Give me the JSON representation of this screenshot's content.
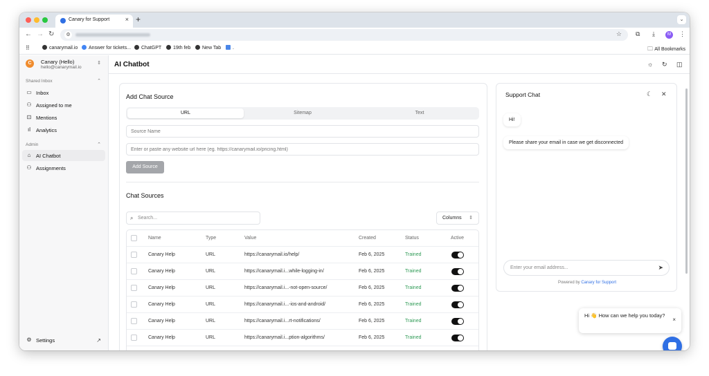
{
  "browser": {
    "tab_title": "Canary for Support",
    "tab_close": "×",
    "new_tab": "+",
    "menu": "⌄",
    "bookmarks": [
      {
        "label": "canarymail.io"
      },
      {
        "label": "Answer for tickets..."
      },
      {
        "label": "ChatGPT"
      },
      {
        "label": "19th feb"
      },
      {
        "label": "New Tab"
      },
      {
        "label": "."
      }
    ],
    "all_bookmarks": "All Bookmarks",
    "profile_initial": "M"
  },
  "workspace": {
    "avatar": "C",
    "name": "Canary (Hello)",
    "email": "hello@canarymail.io"
  },
  "sidebar": {
    "shared_inbox_label": "Shared Inbox",
    "shared_items": [
      {
        "label": "Inbox",
        "icon": "inbox-icon"
      },
      {
        "label": "Assigned to me",
        "icon": "user-check-icon"
      },
      {
        "label": "Mentions",
        "icon": "mention-icon"
      },
      {
        "label": "Analytics",
        "icon": "bar-chart-icon"
      }
    ],
    "admin_label": "Admin",
    "admin_items": [
      {
        "label": "AI Chatbot",
        "icon": "bot-icon",
        "active": true
      },
      {
        "label": "Assignments",
        "icon": "users-icon"
      }
    ],
    "settings_label": "Settings"
  },
  "header": {
    "title": "AI Chatbot"
  },
  "add_source": {
    "title": "Add Chat Source",
    "tabs": [
      "URL",
      "Sitemap",
      "Text"
    ],
    "active_tab": "URL",
    "source_name_placeholder": "Source Name",
    "url_placeholder": "Enter or paste any website url here (eg. https://canarymail.io/pricing.html)",
    "add_button": "Add Source"
  },
  "chat_sources": {
    "title": "Chat Sources",
    "search_placeholder": "Search...",
    "columns_button": "Columns",
    "headers": [
      "Name",
      "Type",
      "Value",
      "Created",
      "Status",
      "Active"
    ],
    "rows": [
      {
        "name": "Canary Help",
        "type": "URL",
        "value": "https://canarymail.io/help/",
        "created": "Feb 6, 2025",
        "status": "Trained",
        "active": true
      },
      {
        "name": "Canary Help",
        "type": "URL",
        "value": "https://canarymail.i...while-logging-in/",
        "created": "Feb 6, 2025",
        "status": "Trained",
        "active": true
      },
      {
        "name": "Canary Help",
        "type": "URL",
        "value": "https://canarymail.i...-not-open-source/",
        "created": "Feb 6, 2025",
        "status": "Trained",
        "active": true
      },
      {
        "name": "Canary Help",
        "type": "URL",
        "value": "https://canarymail.i...-ios-and-android/",
        "created": "Feb 6, 2025",
        "status": "Trained",
        "active": true
      },
      {
        "name": "Canary Help",
        "type": "URL",
        "value": "https://canarymail.i...rt-notifications/",
        "created": "Feb 6, 2025",
        "status": "Trained",
        "active": true
      },
      {
        "name": "Canary Help",
        "type": "URL",
        "value": "https://canarymail.i...ption-algorithms/",
        "created": "Feb 6, 2025",
        "status": "Trained",
        "active": true
      }
    ]
  },
  "support_chat": {
    "title": "Support Chat",
    "messages": [
      "Hi!",
      "Please share your email in case we get disconnected"
    ],
    "input_placeholder": "Enter your email address...",
    "powered_prefix": "Powered by",
    "powered_brand": "Canary for Support"
  },
  "greeting": {
    "text": "Hi 👋 How can we help you today?",
    "close": "×"
  },
  "colors": {
    "accent": "#2f6fe4",
    "status_trained": "#2e9a55",
    "workspace_avatar": "#f08c2e"
  }
}
